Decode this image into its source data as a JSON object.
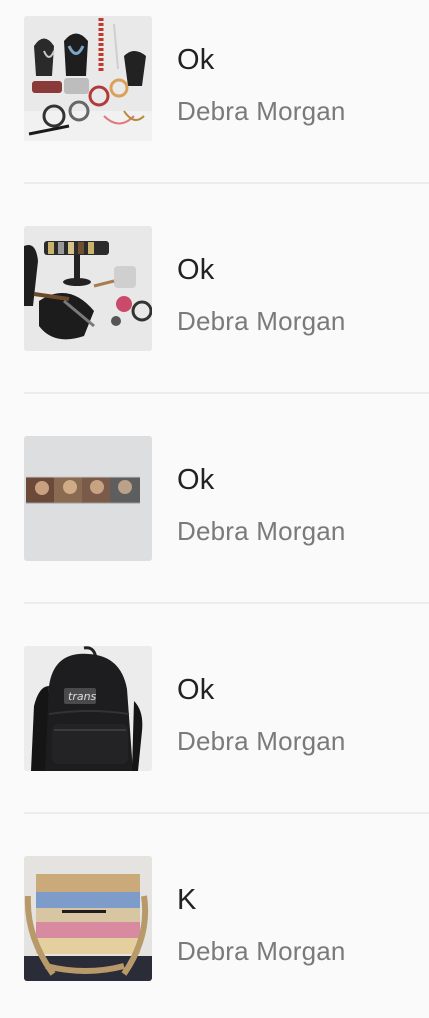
{
  "items": [
    {
      "title": "Ok",
      "seller": "Debra Morgan",
      "image": "jewelry-lot-photo"
    },
    {
      "title": "Ok",
      "seller": "Debra Morgan",
      "image": "bracelets-and-accessories-photo"
    },
    {
      "title": "Ok",
      "seller": "Debra Morgan",
      "image": "cd-cases-photo"
    },
    {
      "title": "Ok",
      "seller": "Debra Morgan",
      "image": "black-backpack-photo"
    },
    {
      "title": "K",
      "seller": "Debra Morgan",
      "image": "striped-crossbody-bag-photo"
    }
  ]
}
